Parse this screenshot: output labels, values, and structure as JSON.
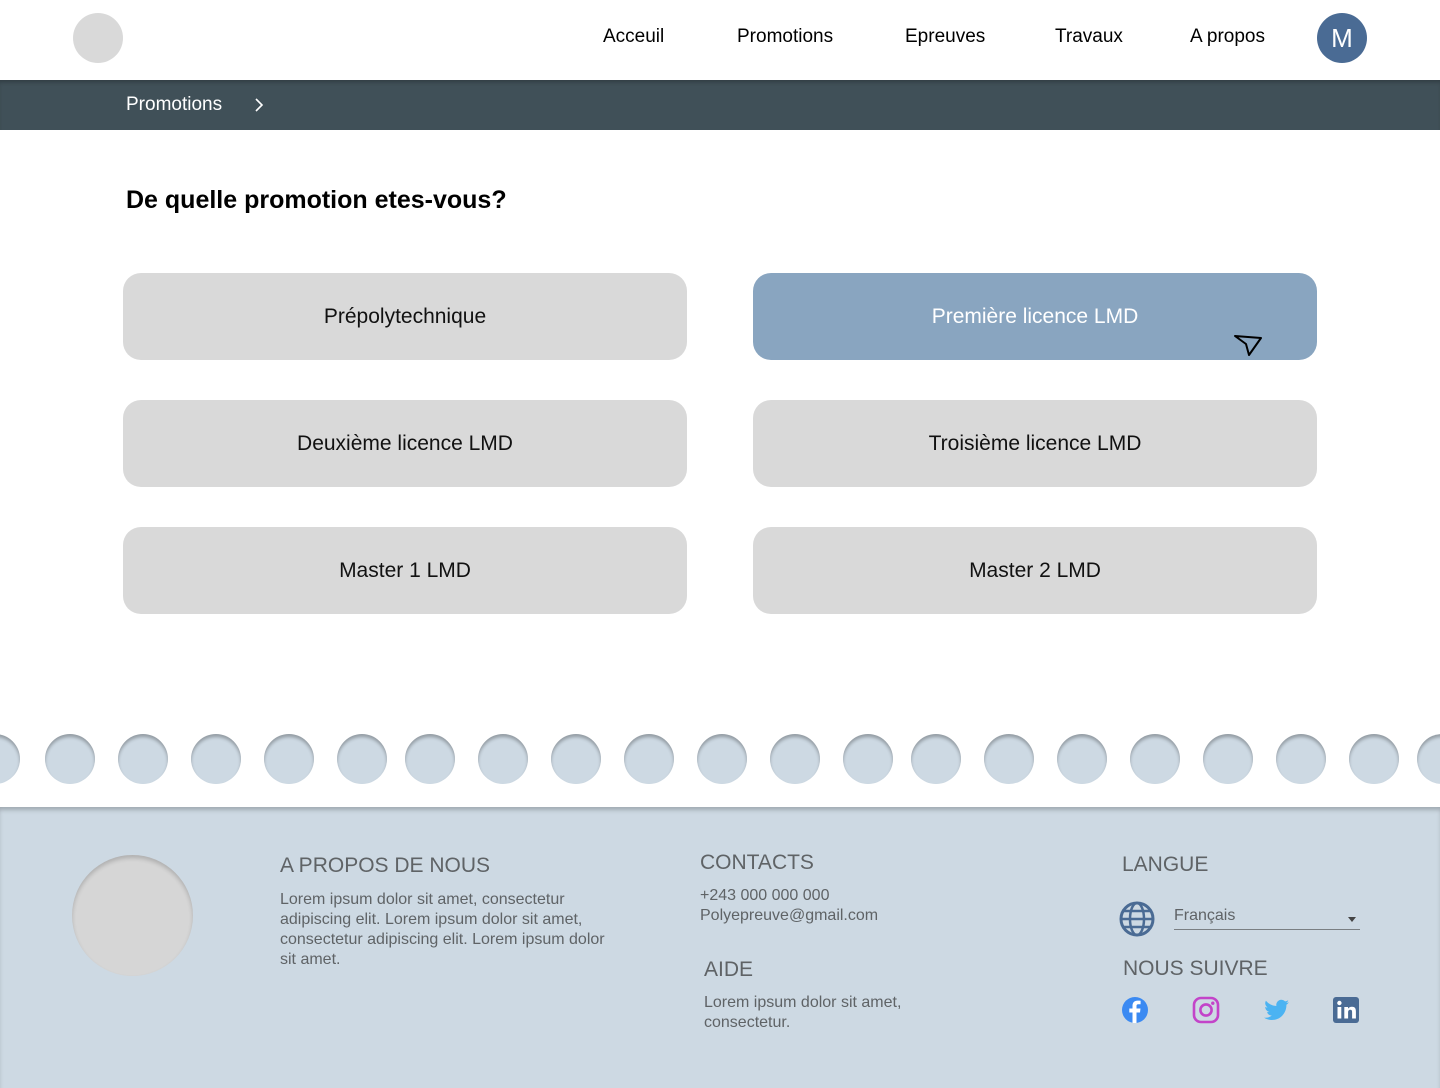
{
  "header": {
    "nav": [
      "Acceuil",
      "Promotions",
      "Epreuves",
      "Travaux",
      "A propos"
    ],
    "avatar_initial": "M",
    "accent_color": "#4a6b94"
  },
  "breadcrumb": {
    "label": "Promotions"
  },
  "main": {
    "title": "De quelle promotion etes-vous?",
    "promotions": [
      "Prépolytechnique",
      "Première licence LMD",
      "Deuxième licence LMD",
      "Troisième licence LMD",
      "Master 1 LMD",
      "Master 2 LMD"
    ],
    "selected_promotion": "Première licence LMD",
    "selected_color": "#89a5c0"
  },
  "footer": {
    "about": {
      "heading": "A PROPOS DE NOUS",
      "text": "Lorem ipsum dolor sit amet, consectetur adipiscing elit. Lorem ipsum dolor sit amet, consectetur adipiscing elit. Lorem ipsum dolor sit amet."
    },
    "contacts": {
      "heading": "CONTACTS",
      "phone": "+243 000 000 000",
      "email": "Polyepreuve@gmail.com"
    },
    "help": {
      "heading": "AIDE",
      "text": "Lorem ipsum dolor sit amet, consectetur."
    },
    "language": {
      "heading": "LANGUE",
      "selected": "Français",
      "icon": "globe-icon"
    },
    "follow": {
      "heading": "NOUS SUIVRE",
      "icons": [
        "facebook-icon",
        "instagram-icon",
        "twitter-icon",
        "linkedin-icon"
      ]
    },
    "background_color": "#cdd9e3"
  }
}
